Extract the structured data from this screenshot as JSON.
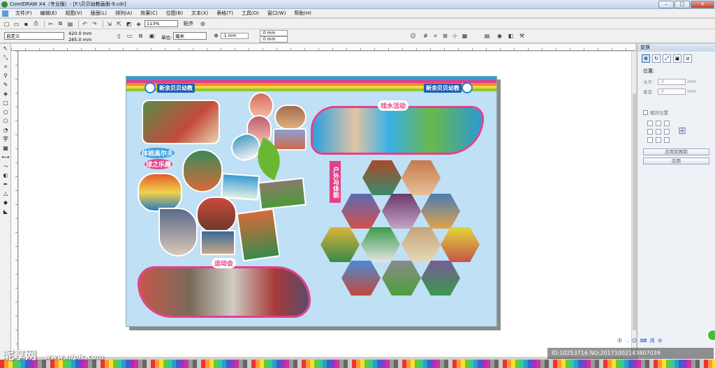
{
  "window": {
    "title": "CorelDRAW X4（专业版）- [F:\\贝贝幼教画册-9.cdr]",
    "min": "–",
    "max": "□",
    "close": "✕"
  },
  "menu": [
    "文件(F)",
    "编辑(E)",
    "视图(V)",
    "版面(L)",
    "排列(A)",
    "效果(C)",
    "位图(B)",
    "文本(X)",
    "表格(T)",
    "工具(O)",
    "窗口(W)",
    "帮助(H)"
  ],
  "toolbar": {
    "zoom": "113%",
    "snap": "贴齐"
  },
  "propbar": {
    "preset": "自定义",
    "width": "420.0 mm",
    "height": "285.0 mm",
    "unit_label": "单位:",
    "unit": "毫米",
    "nudge": ".1 mm",
    "dup_x": ".0 mm",
    "dup_y": ".0 mm"
  },
  "design": {
    "brand_left": "新余贝贝幼教",
    "brand_right": "新余贝贝幼教",
    "golf_line1": "体验高尔夫",
    "golf_line2": "球之乐趣",
    "water": "戏水活动",
    "outdoor": "户外与体能",
    "sports": "运动会"
  },
  "docker": {
    "title": "变换",
    "position": "位置:",
    "h_label": "水平:",
    "v_label": "垂直:",
    "h_value": ".0",
    "v_value": ".0",
    "unit": "mm",
    "relative": "相对位置",
    "apply_dup": "应用到再制",
    "apply": "应用"
  },
  "watermark": {
    "site": "昵享网",
    "url": "www.nipic.com",
    "id": "ID:10253716 NO:20171002143807039"
  },
  "ime": "中 ·, ☺ ⌨ 简 ⚙",
  "colors": {
    "pink": "#e2418a",
    "sky": "#bfe0f5",
    "brand_blue": "#1b5fae"
  }
}
